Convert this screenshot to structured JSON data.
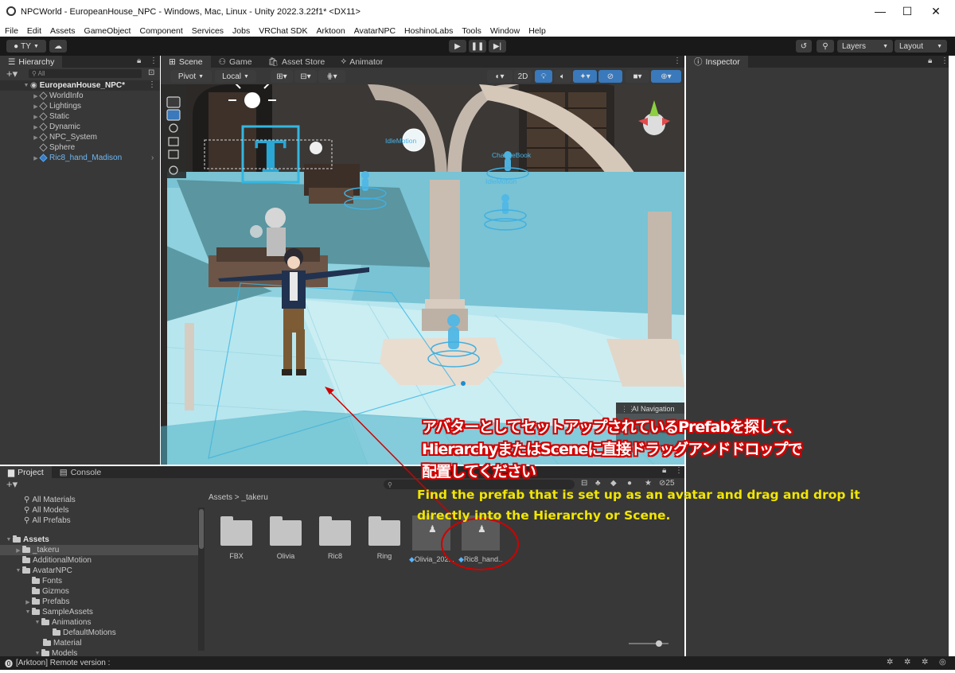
{
  "window": {
    "title": "NPCWorld - EuropeanHouse_NPC - Windows, Mac, Linux - Unity 2022.3.22f1* <DX11>",
    "min": "—",
    "max": "☐",
    "close": "✕"
  },
  "menu": [
    "File",
    "Edit",
    "Assets",
    "GameObject",
    "Component",
    "Services",
    "Jobs",
    "VRChat SDK",
    "Arktoon",
    "AvatarNPC",
    "HoshinoLabs",
    "Tools",
    "Window",
    "Help"
  ],
  "toolbar": {
    "account": "TY",
    "layers": "Layers",
    "layout": "Layout"
  },
  "hierarchy": {
    "tab": "Hierarchy",
    "search_placeholder": "All",
    "root": "EuropeanHouse_NPC*",
    "items": [
      "WorldInfo",
      "Lightings",
      "Static",
      "Dynamic",
      "NPC_System",
      "Sphere",
      "Ric8_hand_Madison"
    ]
  },
  "scene": {
    "tabs": [
      "Scene",
      "Game",
      "Asset Store",
      "Animator"
    ],
    "pivot": "Pivot",
    "local": "Local",
    "mode_2d": "2D",
    "ai_navigation": "AI Navigation",
    "labels": [
      "IdleMotion",
      "ChangeBook",
      "IdleMotion"
    ],
    "text_gizmo": "T"
  },
  "inspector": {
    "tab": "Inspector"
  },
  "project": {
    "tabs": [
      "Project",
      "Console"
    ],
    "favorites": [
      "All Materials",
      "All Models",
      "All Prefabs"
    ],
    "tree": [
      {
        "label": "Assets",
        "depth": 0
      },
      {
        "label": "_takeru",
        "depth": 1
      },
      {
        "label": "AdditionalMotion",
        "depth": 1
      },
      {
        "label": "AvatarNPC",
        "depth": 1
      },
      {
        "label": "Fonts",
        "depth": 2
      },
      {
        "label": "Gizmos",
        "depth": 2
      },
      {
        "label": "Prefabs",
        "depth": 2
      },
      {
        "label": "SampleAssets",
        "depth": 2
      },
      {
        "label": "Animations",
        "depth": 3
      },
      {
        "label": "DefaultMotions",
        "depth": 4
      },
      {
        "label": "Material",
        "depth": 3
      },
      {
        "label": "Models",
        "depth": 3
      }
    ],
    "breadcrumb": [
      "Assets",
      "_takeru"
    ],
    "hidden_count": "25",
    "assets": [
      {
        "name": "FBX",
        "kind": "folder"
      },
      {
        "name": "Olivia",
        "kind": "folder"
      },
      {
        "name": "Ric8",
        "kind": "folder"
      },
      {
        "name": "Ring",
        "kind": "folder"
      },
      {
        "name": "Olivia_202...",
        "kind": "prefab"
      },
      {
        "name": "Ric8_hand...",
        "kind": "prefab"
      }
    ]
  },
  "status": {
    "text": "[Arktoon] Remote version :"
  },
  "annotation": {
    "jp_line1": "アバターとしてセットアップされているPrefabを探して、",
    "jp_line2": "HierarchyまたはSceneに直接ドラッグアンドドロップで",
    "jp_line3": "配置してください",
    "en_line1": "Find the prefab that is set up as an avatar and drag and drop it",
    "en_line2": "directly into the Hierarchy or Scene."
  },
  "colors": {
    "annotation_red": "#d10000",
    "annotation_yellow": "#f2e600",
    "selection_blue": "#2c5d87",
    "panel": "#383838"
  }
}
